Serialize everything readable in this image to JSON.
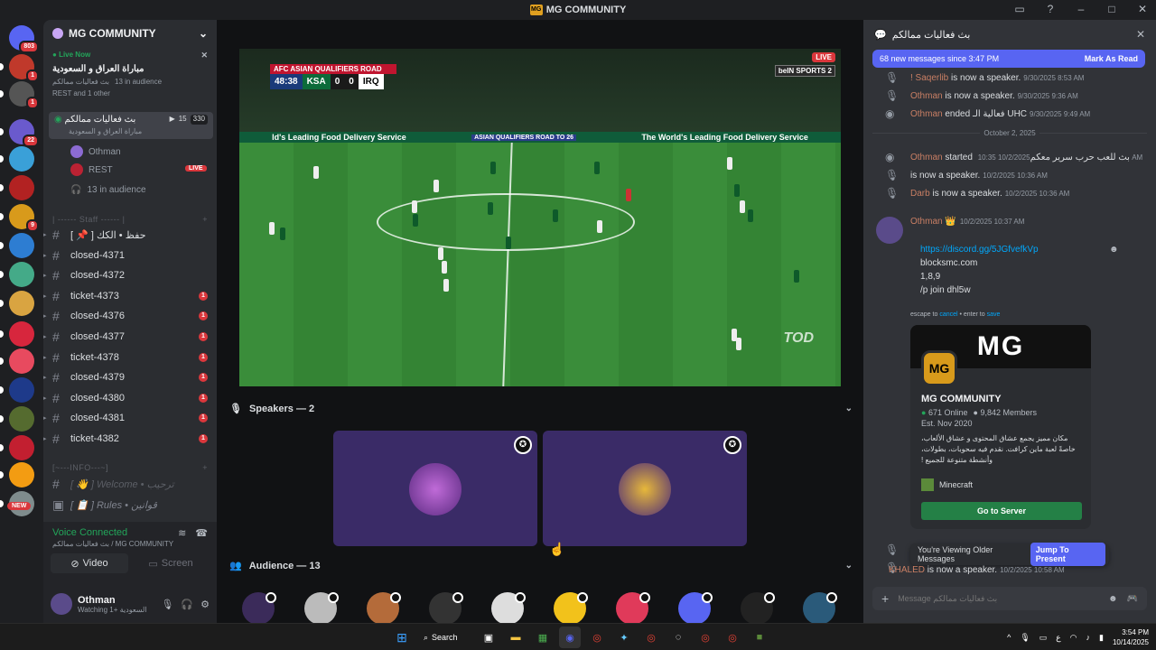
{
  "window": {
    "title": "MG COMMUNITY"
  },
  "rail": {
    "dm_badge": "803",
    "new_label": "NEW",
    "servers": [
      {
        "color": "#c0392b",
        "badge": "1"
      },
      {
        "color": "#555",
        "badge": "1"
      },
      {
        "color": "#6a5acd",
        "badge": "22"
      },
      {
        "color": "#3aa0d8",
        "badge": ""
      },
      {
        "color": "#b22222",
        "badge": ""
      },
      {
        "color": "#d89a1b",
        "badge": "9"
      },
      {
        "color": "#2d7dd2",
        "badge": ""
      },
      {
        "color": "#4a8",
        "badge": ""
      },
      {
        "color": "#d9a441",
        "badge": ""
      },
      {
        "color": "#d7263d",
        "badge": ""
      },
      {
        "color": "#e84a5f",
        "badge": ""
      },
      {
        "color": "#1e3a8a",
        "badge": ""
      },
      {
        "color": "#556b2f",
        "badge": ""
      },
      {
        "color": "#c21f30",
        "badge": ""
      },
      {
        "color": "#f39c12",
        "badge": ""
      },
      {
        "color": "#7f8c8d",
        "badge": ""
      }
    ]
  },
  "sidebar": {
    "server_name": "MG COMMUNITY",
    "live_card": {
      "live_now": "Live Now",
      "title": "مباراة العراق و السعودية",
      "channel": "بث فعاليات ممالكم",
      "audience": "13 in audience",
      "others": "REST and 1 other"
    },
    "voice_channel": {
      "name": "بث فعاليات ممالكم",
      "sub": "مباراة العراق و السعودية",
      "count_a": "15",
      "count_b": "330",
      "users": [
        {
          "name": "Othman",
          "live": ""
        },
        {
          "name": "REST",
          "live": "LIVE"
        }
      ],
      "audience": "13 in audience"
    },
    "staff_category": "| ------ Staff ------ |",
    "channels": [
      {
        "name": "[ 📌 ] حفظ • الكك",
        "badge": ""
      },
      {
        "name": "closed-4371",
        "badge": ""
      },
      {
        "name": "closed-4372",
        "badge": ""
      },
      {
        "name": "ticket-4373",
        "badge": "1"
      },
      {
        "name": "closed-4376",
        "badge": "1"
      },
      {
        "name": "closed-4377",
        "badge": "1"
      },
      {
        "name": "ticket-4378",
        "badge": "1"
      },
      {
        "name": "closed-4379",
        "badge": "1"
      },
      {
        "name": "closed-4380",
        "badge": "1"
      },
      {
        "name": "closed-4381",
        "badge": "1"
      },
      {
        "name": "ticket-4382",
        "badge": "1"
      }
    ],
    "info_category": "[~---INFO---~]",
    "info_channels": [
      {
        "name": "[ 👋 ] Welcome • ترحيب"
      },
      {
        "name": "[ 📋 ] Rules • قوانين"
      }
    ]
  },
  "voice_panel": {
    "status": "Voice Connected",
    "location": "بث فعاليات ممالكم / MG COMMUNITY",
    "video_label": "Video",
    "screen_label": "Screen"
  },
  "user": {
    "name": "Othman",
    "status": "Watching السعودية +1"
  },
  "stage": {
    "scorebug_top": "AFC ASIAN QUALIFIERS  ROAD TO 26",
    "clock": "48:38",
    "team1": "KSA",
    "score1": "0",
    "score2": "0",
    "team2": "IRQ",
    "live": "LIVE",
    "broadcaster": "beIN SPORTS 2",
    "ad_text_1": "ld's Leading Food Delivery Service",
    "ad_text_2": "ASIAN QUALIFIERS ROAD TO 26",
    "ad_text_3": "The World's Leading Food Delivery Service",
    "watermark": "TOD",
    "speakers_label": "Speakers — 2",
    "audience_label": "Audience — 13"
  },
  "chat": {
    "header": "بث فعاليات ممالكم",
    "new_messages": "68 new messages since 3:47 PM",
    "mark_read": "Mark As Read",
    "system": [
      {
        "user": "! Saqerlib",
        "text": " is now a speaker.",
        "time": "9/30/2025 8:53 AM"
      },
      {
        "user": "Othman",
        "text": " is now a speaker.",
        "time": "9/30/2025 9:36 AM"
      },
      {
        "user": "Othman",
        "text": " ended فعالية الـ UHC",
        "time": "9/30/2025 9:49 AM"
      },
      {
        "user": "Othman",
        "text": " started بث للعب حرب سرير معكم",
        "time": "10/2/2025 10:35 AM"
      },
      {
        "user": "",
        "text": " is now a speaker.",
        "time": "10/2/2025 10:36 AM"
      },
      {
        "user": "Darb",
        "text": " is now a speaker.",
        "time": "10/2/2025 10:36 AM"
      }
    ],
    "date_divider": "October 2, 2025",
    "message": {
      "author": "Othman 👑",
      "time": "10/2/2025 10:37 AM",
      "lines": [
        "https://discord.gg/5JGfvefkVp",
        "blocksmc.com",
        "1,8,9",
        "/p join dhl5w"
      ]
    },
    "escape_text": "escape to",
    "cancel": "cancel",
    "enter_text": "• enter to",
    "save": "save",
    "invite": {
      "banner": "MG",
      "icon": "MG",
      "name": "MG COMMUNITY",
      "online": "671 Online",
      "members": "9,842 Members",
      "est": "Est. Nov 2020",
      "desc": "مكان مميز يجمع عشاق المحتوى و عشاق الألعاب، خاصةً لعبة ماين كرافت. نقدم فيه سحوبات، بطولات، وأنشطة متنوعة للجميع !",
      "game": "Minecraft",
      "button": "Go to Server"
    },
    "older_text": "You're Viewing Older Messages",
    "jump": "Jump To Present",
    "last_sys": {
      "user": "KHALED",
      "text": " is now a speaker.",
      "time": "10/2/2025 10:58 AM"
    },
    "placeholder": "Message بث فعاليات ممالكم"
  },
  "taskbar": {
    "search": "Search",
    "time": "3:54 PM",
    "date": "10/14/2025",
    "lang": "ع"
  }
}
